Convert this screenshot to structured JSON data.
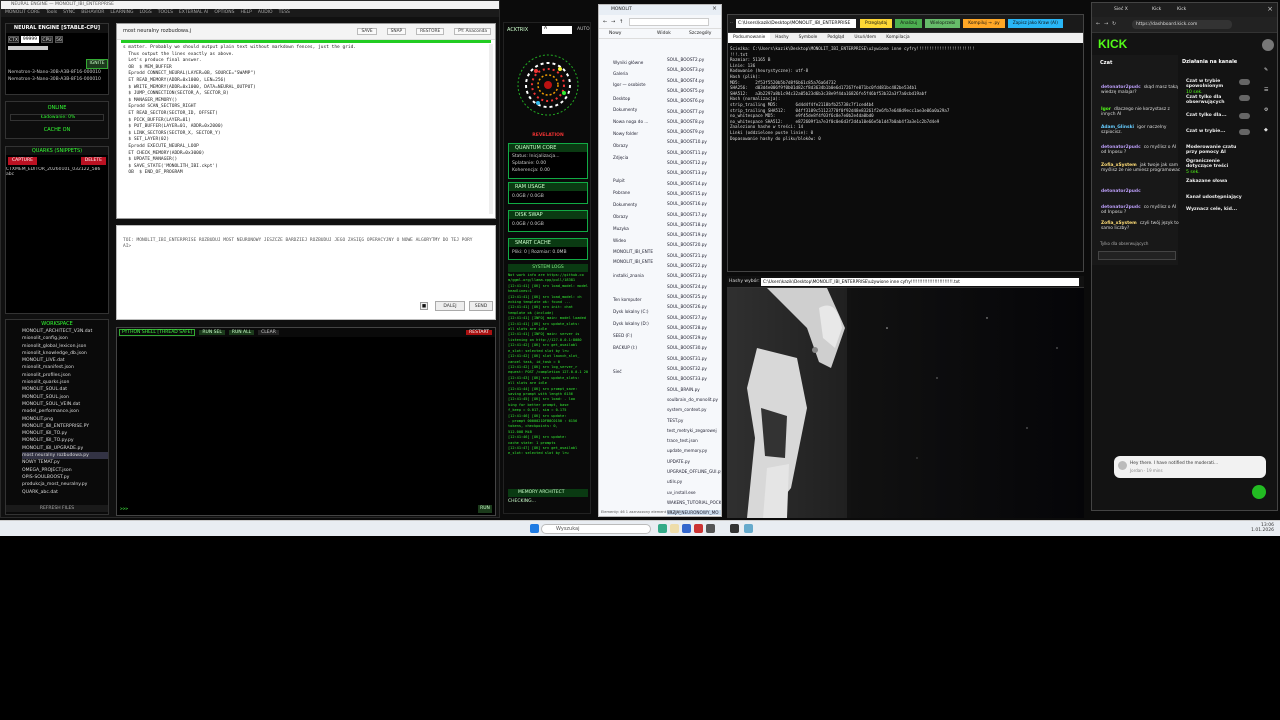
{
  "w1": {
    "title": "NEURAL ENGINE — MONOLIT_IBI_ENTERPRISE",
    "menu": [
      "MONOLIT CORE",
      "Tools",
      "SYNC",
      "BEHAVIOR",
      "LEARNING",
      "LOGS",
      "TOOLS",
      "EXTERNAL AI",
      "OPTIONS",
      "HELP",
      "AUDIO",
      "TESS"
    ],
    "engine_title": "NEURAL ENGINE [STABLE-CPU]",
    "ctx_label": "CTX",
    "ctx_value": "99999",
    "cpu": "CPU",
    "models": [
      "Nemotron-3-Nano-30B-A3B-8F16-000010",
      "Nemotron-3-Nano-30B-A3B-8F16-000010"
    ],
    "ignite": "IGNITE",
    "online": "ONLINE",
    "loading": "Ładowanie: 0%",
    "cache": "CACHE ON",
    "quarks_title": "QUARKS (SNIPPETS)",
    "capture": "CAPTURE",
    "delete": "DELETE",
    "quark_item": "CTXMEM_EDITOR_20260101_032122_586",
    "quark_item2": "abc",
    "workspace_title": "WORKSPACE",
    "workspace": [
      "MONOLIT_ARCHITECT_V3N.dat",
      "mionolit_config.json",
      "mionolit_global_lexicon.json",
      "mionolit_knowledge_db.json",
      "MONOLIT_LIVE.dat",
      "mionolit_manifest.json",
      "mionolit_profiles.json",
      "mionolit_quarks.json",
      "MONOLIT_SOUL.dat",
      "MONOLIT_SOUL.json",
      "MONOLIT_SOUL_VEIN.dat",
      "model_performance.json",
      "MONOLIT.png",
      "MONOLIT_IBI_ENTERPRISE.PY",
      "MONOLIT_IBI_TO.py",
      "MONOLIT_IBI_TO.py.py",
      "MONOLIT_IBI_UPGRADE.py",
      "most neuralny rozbudowa.py",
      "NOWY TEMAT.py",
      "OMEGA_PROJECT.json",
      "OPIS-SOULBOOST.py",
      "produkcja_most_neuralny.py",
      "QUARK_abc.dat"
    ],
    "refresh": "REFRESH FILES",
    "editor_tab": "most neuralny rozbudowa.j",
    "toolbar": [
      "SAVE",
      "SNAP",
      "RESTORE",
      "PY: Anaconda"
    ],
    "code": [
      "s matter. Probably we should output plain text without markdown fences, just the grid.",
      "",
      "  Thus output the lines exactly as above.",
      "",
      "  Let's produce final answer.",
      "",
      "",
      "  OB  $ MEM_BUFFER",
      "  Eprodd CONNECT_NEURAL(LAYER=0B, SOURCE=\"SWAMP\")",
      "  ET READ_MEMORY(ADDR=0x1000, LEN=256)",
      "  $ WRITE_MEMORY(ADDR=0x1000, DATA=NEURAL_OUTPUT)",
      "  $ JUMP_CONNECTION(SECTOR_A, SECTOR_B)",
      "  $ MANAGER_MEMORY()",
      "  Eprodd SCAN_SECTORS_RIGHT",
      "  ET READ_SECTOR(SECTOR_ID, OFFSET)",
      "  $ PICK_BUFFER(LAYER=01)",
      "  $ PUT_BUFFER(LAYER=01, ADDR=0x2000)",
      "  $ LINK_SECTORS(SECTOR_X, SECTOR_Y)",
      "  $ SET_LAYER(02)",
      "  Eprodd EXECUTE_NEURAL_LOOP",
      "  ET CHECK_MEMORY(ADDR=0x3000)",
      "  $ UPDATE_MANAGER()",
      "  $ SAVE_STATE('MONOLITH_IBI.ckpt')",
      "  OB  $ END_OF_PROGRAM"
    ],
    "prompt_text": "TOI: MONOLIT_IBI_ENTERPRISE ROZBUDUJ MOST NEURONOWY JESZCZE BARDZIEJ ROZBUDUJ JEGO ZASIĘG OPERACYJNY O NOWE ALGORYTMY DO TEJ PORY",
    "prompt_sub": "AI>",
    "dalej": "DALEJ",
    "send": "SEND",
    "shell_title": "PYTHON SHELL [THREAD SAFE]",
    "run_sel": "RUN SEL",
    "run_all": "RUN ALL",
    "clear": "CLEAR",
    "restart": "RESTART",
    "shell_prompt": ">>>",
    "run": "RUN"
  },
  "w2": {
    "actrix": "ACKTRIX",
    "auto": "AUTO",
    "revelation": "REVELATION",
    "quantum_title": "QUANTUM CORE",
    "quantum": [
      "Status: Inicjalizacja...",
      "Splatanie: 0.00",
      "Koherencja: 0.00"
    ],
    "ram_title": "RAM USAGE",
    "ram": "0.0GB / 0.0GB",
    "disk_title": "DISK SWAP",
    "disk": "0.0GB / 0.0GB",
    "cache_title": "SMART CACHE",
    "cache": "Pliki: 0 | Rozmiar: 0.0MB",
    "logs_title": "SYSTEM LOGS",
    "logs": [
      "Not work info are https://github.co",
      "m/ggml-org/llama.cpp/pull/18381",
      "[12:41:41] [OK] srv  load_model: model",
      "headlines=1",
      "[12:41:41] [OK] srv  load_model: ch",
      "ecking template ok: found ...",
      "[12:41:41] [OK] srv  init: chat",
      "template ok (include)",
      "[12:41:41] [INFO] main: model loaded",
      "[12:41:41] [OK] srv  update_slots:",
      "all slots are idle",
      "[12:41:41] [INFO] main: server is",
      "listening on http://127.0.0.1:8080",
      "[12:41:42] [OK] srv  get_availabl",
      "e_slot: selected slot by lru",
      "[12:41:42] [OK] slot launch_slot_",
      "cancel task, id_task = 0",
      "[12:41:42] [OK] srv  log_server_r",
      "equest: POST /completion 127.0.0.1 200",
      "[12:41:43] [OK] srv  update_slots:",
      "all slots are idle",
      "[12:41:44] [OK] srv  prompt_save:",
      "saving prompt with length 6156",
      "[12:41:45] [OK] srv  load: - loo",
      "king for better prompt, base",
      "f_keep = 0.017, sim = 0.175",
      "[12:41:46] [OK] srv  update:",
      "- prompt 0000021DFB8C0150 : 6156",
      "tokens, checkpoints: 0,",
      "512.008 MiB",
      "[12:41:46] [OK] srv  update:",
      "cache state: 1 prompts",
      "[12:41:47] [OK] srv  get_availabl",
      "e_slot: selected slot by lru"
    ],
    "memory_arch": "MEMORY ARCHITECT",
    "checking": "CHECKING..."
  },
  "w3": {
    "title": "MONOLIT",
    "new": "Nowy",
    "sort": "Sortuj",
    "view": "Widok",
    "details": "Szczegóły",
    "nav": [
      "Wyniki główne",
      "Galeria",
      "Igor — osobiste",
      "Desktop",
      "Dokumenty",
      "Nowa noga do ...",
      "Nowy folder",
      "Obrazy",
      "Zdjęcia",
      "Pulpit",
      "Pobrane",
      "Dokumenty",
      "Obrazy",
      "Muzyka",
      "Wideo",
      "MONOLIT_IBI_ENTE",
      "MONOLIT_IBI_ENTE",
      "instalki_znania",
      "Ten komputer",
      "Dysk lokalny (C:)",
      "Dysk lokalny (D:)",
      "SEED (F:)",
      "BACKUP (I:)",
      "Sieć"
    ],
    "files": [
      "SOUL_BOOST2.py",
      "SOUL_BOOST3.py",
      "SOUL_BOOST4.py",
      "SOUL_BOOST5.py",
      "SOUL_BOOST6.py",
      "SOUL_BOOST7.py",
      "SOUL_BOOST8.py",
      "SOUL_BOOST9.py",
      "SOUL_BOOST10.py",
      "SOUL_BOOST11.py",
      "SOUL_BOOST12.py",
      "SOUL_BOOST13.py",
      "SOUL_BOOST14.py",
      "SOUL_BOOST15.py",
      "SOUL_BOOST16.py",
      "SOUL_BOOST17.py",
      "SOUL_BOOST18.py",
      "SOUL_BOOST19.py",
      "SOUL_BOOST20.py",
      "SOUL_BOOST21.py",
      "SOUL_BOOST22.py",
      "SOUL_BOOST23.py",
      "SOUL_BOOST24.py",
      "SOUL_BOOST25.py",
      "SOUL_BOOST26.py",
      "SOUL_BOOST27.py",
      "SOUL_BOOST28.py",
      "SOUL_BOOST29.py",
      "SOUL_BOOST30.py",
      "SOUL_BOOST31.py",
      "SOUL_BOOST32.py",
      "SOUL_BOOST33.py",
      "SOUL_BRAIN.py",
      "soulbrain_do_monolit.py",
      "system_context.py",
      "TEST.py",
      "test_metryki_zegarowej",
      "trace_test.json",
      "update_memory.py",
      "UPDATE.py",
      "UPGRADE_OFFLINE_GUI.py",
      "utils.py",
      "uv_install.exe",
      "WAKENS_TUTORIAL_POCKE",
      "WIZJA_NEURONOWY_MO"
    ],
    "status": "Elementy: 46     1 zaznaczony element  73,1 kB"
  },
  "w4": {
    "path": "C:\\Users\\kazik\\Desktop\\MONOLIT_IBI_ENTERPRISE",
    "buttons": [
      "Przeglądaj",
      "Analizuj",
      "Wieloprzebi",
      "Kompiluj → .py",
      "Zapisz jako Kraw (AI)"
    ],
    "tabs": [
      "Podsumowanie",
      "Hashy",
      "Symbole",
      "Podgląd",
      "Usuń/dem",
      "Kompilacja"
    ],
    "lines": [
      "Ścieżka: C:\\Users\\kazik\\Desktop\\MONOLIT_IBI_ENTERPRISE\\używione inne cyfry!!!!!!!!!!!!!!!!!!!!!!!",
      "!!!.txt",
      "Rozmiar: 51165 B",
      "Linie: 136",
      "Kodowanie (heurystyczne): utf-8",
      "",
      "Hash (plik):",
      "MD5:      2f53f5520b5b7d8f6b61c85a76a64732",
      "SHA256:   d03d4e006f9f0b01d82cf8d3634b1b0e6d17267fe071bc0fd481bc482be534b1",
      "SHA512:   a3b2297a8b1c94c32a05b23d6b3c38e9f4da16826fe5f46bf53b32a3f7a0cbd19abf",
      "",
      "Hash (normalizacja):",
      "strip_trailing MD5:       6d4d4f4fe2118bfb25738c7f1ced4b4",
      "strip_trailing SHA512:    04ff3109c51123770f0f92d48e83261f2e6fb7e648d9ecc1ae3e06a0a29a7",
      "no_whitespace MD5:        e9f45de8f4f03f6c8e7e0b2e4da0bd0",
      "no_whitespace SHA512:     e872609f1a7e3f0c0e6d3f2d4a10e66e5b1d47b0ab4f3a3e1c2b7d4e9",
      "",
      "Znaleziono hashe w treści: 14",
      "Linki (oddzielone puste linie): 0",
      "Dopasowanie hashy do pliku/bloków: 0"
    ],
    "bottom_label": "Hashy wybór:",
    "bottom_path": "C:\\Users\\kazik\\Desktop\\MONOLIT_IBI_ENTERPRISE\\używione inne cyfry!!!!!!!!!!!!!!!!!!!!!!!!!.txt"
  },
  "w6": {
    "tabs": [
      "Sieć X",
      "Kick",
      "Kick"
    ],
    "url": "https://dashboard.kick.com",
    "logo": "KICK",
    "chat_title": "Czat",
    "chat": [
      {
        "user": "detonator2pudc",
        "text": "skąd masz taką wiedzę malajar?"
      },
      {
        "user": "Igor",
        "text": "dlaczego nie korzystasz z innych AI"
      },
      {
        "user": "Adam_Glinski",
        "text": "igor naczelny szpiocisz."
      },
      {
        "user": "detonator2pudc",
        "text": "co myślisz o AI od Inposu ?"
      },
      {
        "user": "Zofia_xSystem",
        "text": "jak twoje jak sam myślisz że nie umiesz programowac"
      },
      {
        "user": "detonator2pudc",
        "text": ""
      },
      {
        "user": "detonator2pudc",
        "text": "co myślisz o AI od Inposu ?"
      },
      {
        "user": "Zofia_xSystem",
        "text": "czyli twój język to samo liczby?"
      }
    ],
    "chat_footer": "Tylko dla obserwujących",
    "settings_title": "Działania na kanale",
    "settings": [
      {
        "label": "Czat w trybie spowolnionym",
        "sub": "10 sek."
      },
      {
        "label": "Czat tylko dla obserwujących",
        "sub": ""
      },
      {
        "label": "Czat tylko dla...",
        "sub": ""
      },
      {
        "label": "Czat w trybie...",
        "sub": ""
      },
      {
        "label": "Moderowanie czatu przy pomocy AI",
        "sub": ""
      },
      {
        "label": "Ograniczenie dotyczące treści",
        "sub": "5 sek."
      },
      {
        "label": "Zakazane słowa",
        "sub": ""
      },
      {
        "label": "Kanał udostępniający",
        "sub": ""
      },
      {
        "label": "Wyznacz cele, kid...",
        "sub": ""
      }
    ],
    "notice": "Hey there. I have notified the moderati...",
    "notice_sub": "Jordan · 19 mins"
  },
  "taskbar": {
    "search": "Wyszukaj",
    "time": "13:06",
    "date": "1.01.2026"
  }
}
